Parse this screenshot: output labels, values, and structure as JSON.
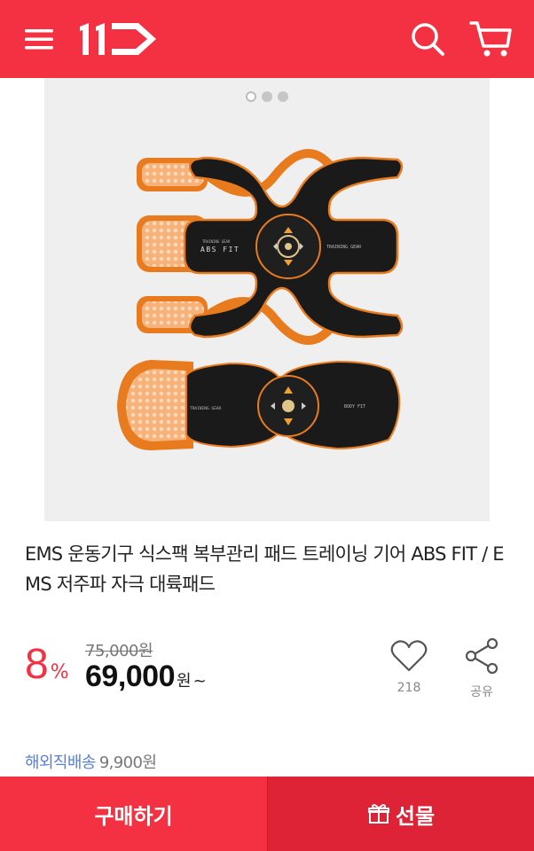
{
  "header": {
    "menu_icon": "hamburger-menu-icon",
    "logo_text": "11",
    "search_icon": "search-icon",
    "cart_icon": "shopping-cart-icon",
    "brand_color": "#f43142"
  },
  "gallery": {
    "slide_count": 3,
    "active_slide": 1
  },
  "product": {
    "title": "EMS 운동기구 식스팩 복부관리 패드 트레이닝 기어 ABS FIT / EMS 저주파 자극 대륙패드",
    "pad_labels": {
      "abs_left": "ABS FIT",
      "abs_small": "TRAINING GEAR",
      "abs_right": "TRAINING GEAR",
      "body_left": "TRAINING GEAR",
      "body_right": "BODY FIT"
    }
  },
  "pricing": {
    "discount_rate": "8",
    "discount_unit": "%",
    "original_price": "75,000원",
    "sale_price": "69,000",
    "currency": "원",
    "tilde": "~"
  },
  "actions": {
    "like_count": "218",
    "share_label": "공유"
  },
  "shipping": {
    "label": "해외직배송",
    "price": "9,900원"
  },
  "bottom_bar": {
    "buy_label": "구매하기",
    "gift_label": "선물"
  }
}
